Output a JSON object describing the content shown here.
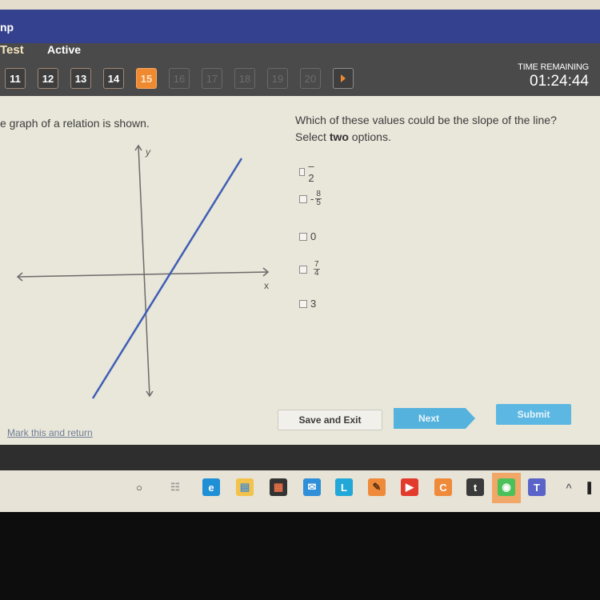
{
  "top_strip": {},
  "header": {
    "app_title_fragment": "np",
    "test_label": "Test",
    "status_label": "Active"
  },
  "question_nav": {
    "buttons": [
      {
        "label": "11",
        "state": "answered"
      },
      {
        "label": "12",
        "state": "answered"
      },
      {
        "label": "13",
        "state": "answered"
      },
      {
        "label": "14",
        "state": "answered"
      },
      {
        "label": "15",
        "state": "current"
      },
      {
        "label": "16",
        "state": "disabled"
      },
      {
        "label": "17",
        "state": "disabled"
      },
      {
        "label": "18",
        "state": "disabled"
      },
      {
        "label": "19",
        "state": "disabled"
      },
      {
        "label": "20",
        "state": "disabled"
      }
    ],
    "next_arrow_icon": "play-arrow-icon",
    "current_color": "#f08a30"
  },
  "timer": {
    "label": "TIME REMAINING",
    "value": "01:24:44"
  },
  "question": {
    "stem_left": "e graph of a relation is shown.",
    "stem_right_line1": "Which of these values could be the slope of the line?",
    "stem_right_prefix": "Select ",
    "stem_right_bold": "two",
    "stem_right_suffix": " options.",
    "graph": {
      "x_label": "x",
      "y_label": "y",
      "line_color": "#3f5fb5",
      "line_direction": "positive slope, steep",
      "y_intercept": "negative",
      "x_intercept": "positive"
    },
    "options": [
      {
        "type": "text",
        "sign": "",
        "text": "–2",
        "checked": false
      },
      {
        "type": "fraction",
        "sign": "-",
        "numerator": "8",
        "denominator": "5",
        "checked": false
      },
      {
        "type": "text",
        "sign": "",
        "text": "0",
        "checked": false
      },
      {
        "type": "fraction",
        "sign": "",
        "numerator": "7",
        "denominator": "4",
        "checked": false
      },
      {
        "type": "text",
        "sign": "",
        "text": "3",
        "checked": false
      }
    ]
  },
  "footer": {
    "mark_link": "Mark this and return",
    "save_exit": "Save and Exit",
    "next": "Next",
    "submit": "Submit",
    "accent": "#55b2dd"
  },
  "taskbar": {
    "items": [
      {
        "name": "cortana-icon",
        "glyph": "○",
        "bg": "",
        "fg": "#333"
      },
      {
        "name": "task-view-icon",
        "glyph": "☷",
        "bg": "",
        "fg": "#999"
      },
      {
        "name": "edge-icon",
        "glyph": "e",
        "bg": "#1f8fd6",
        "fg": "#fff"
      },
      {
        "name": "file-explorer-icon",
        "glyph": "▤",
        "bg": "#f3c24a",
        "fg": "#4a8fd0"
      },
      {
        "name": "store-icon",
        "glyph": "▦",
        "bg": "#333",
        "fg": "#e8704a"
      },
      {
        "name": "mail-icon",
        "glyph": "✉",
        "bg": "#2f8fd8",
        "fg": "#fff"
      },
      {
        "name": "l-app-icon",
        "glyph": "L",
        "bg": "#22a8d8",
        "fg": "#fff"
      },
      {
        "name": "sketch-app-icon",
        "glyph": "✎",
        "bg": "#ef8a3a",
        "fg": "#5a3010"
      },
      {
        "name": "youtube-icon",
        "glyph": "▶",
        "bg": "#e33a2e",
        "fg": "#fff"
      },
      {
        "name": "crunchyroll-icon",
        "glyph": "C",
        "bg": "#ef8a3a",
        "fg": "#fff"
      },
      {
        "name": "tumblr-icon",
        "glyph": "t",
        "bg": "#3a3a3a",
        "fg": "#fff"
      },
      {
        "name": "spotify-icon",
        "glyph": "◉",
        "bg": "#4cc05a",
        "fg": "#fff"
      },
      {
        "name": "teams-icon",
        "glyph": "T",
        "bg": "#5a63c8",
        "fg": "#fff"
      },
      {
        "name": "tray-chevron-up-icon",
        "glyph": "^",
        "bg": "",
        "fg": "#666"
      },
      {
        "name": "battery-icon",
        "glyph": "▌",
        "bg": "",
        "fg": "#222"
      }
    ]
  }
}
